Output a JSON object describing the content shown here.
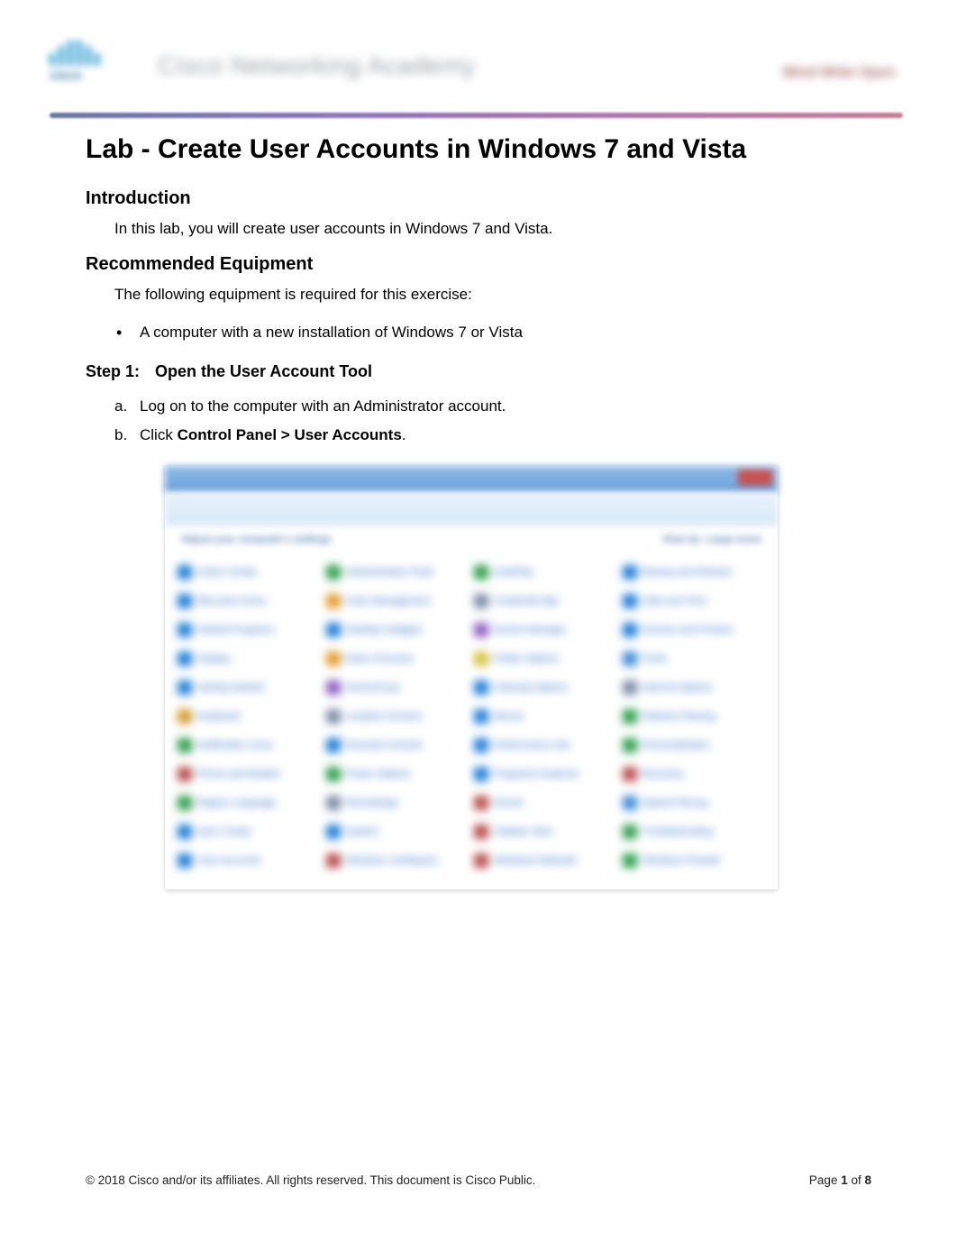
{
  "banner": {
    "logo_text": "cisco",
    "title": "Cisco Networking Academy",
    "right": "Mind Wide Open"
  },
  "doc": {
    "title": "Lab - Create User Accounts in Windows 7 and Vista",
    "intro_heading": "Introduction",
    "intro_body": "In this lab, you will create user accounts in Windows 7 and Vista.",
    "equip_heading": "Recommended Equipment",
    "equip_body": "The following equipment is required for this exercise:",
    "equip_items": [
      "A computer with a new installation of Windows 7 or Vista"
    ],
    "step1_label": "Step 1:",
    "step1_title": "Open the User Account Tool",
    "step1_items": [
      {
        "marker": "a.",
        "text": "Log on to the computer with an Administrator account."
      },
      {
        "marker": "b.",
        "prefix": "Click ",
        "bold": "Control Panel > User Accounts",
        "suffix": "."
      }
    ]
  },
  "screenshot": {
    "subbar_left": "Adjust your computer's settings",
    "subbar_right": "View by: Large icons",
    "items": [
      {
        "color": "#1f7dd8",
        "label": "Action Center"
      },
      {
        "color": "#2a9d4a",
        "label": "Administrative Tools"
      },
      {
        "color": "#2a9d4a",
        "label": "AutoPlay"
      },
      {
        "color": "#1f7dd8",
        "label": "Backup and Restore"
      },
      {
        "color": "#1f7dd8",
        "label": "BitLocker Drive..."
      },
      {
        "color": "#e39a2b",
        "label": "Color Management"
      },
      {
        "color": "#7a8aa5",
        "label": "Credential Mgr"
      },
      {
        "color": "#1f7dd8",
        "label": "Date and Time"
      },
      {
        "color": "#1f7dd8",
        "label": "Default Programs"
      },
      {
        "color": "#1f7dd8",
        "label": "Desktop Gadgets"
      },
      {
        "color": "#8a5cc2",
        "label": "Device Manager"
      },
      {
        "color": "#1f7dd8",
        "label": "Devices and Printers"
      },
      {
        "color": "#1f7dd8",
        "label": "Display"
      },
      {
        "color": "#e39a2b",
        "label": "Ease of Access"
      },
      {
        "color": "#d6c23a",
        "label": "Folder Options"
      },
      {
        "color": "#3a8ad6",
        "label": "Fonts"
      },
      {
        "color": "#1f7dd8",
        "label": "Getting Started"
      },
      {
        "color": "#8a5cc2",
        "label": "HomeGroup"
      },
      {
        "color": "#1f7dd8",
        "label": "Indexing Options"
      },
      {
        "color": "#7a8aa5",
        "label": "Internet Options"
      },
      {
        "color": "#d39a2b",
        "label": "Keyboard"
      },
      {
        "color": "#7a8aa5",
        "label": "Location Sensors"
      },
      {
        "color": "#1f7dd8",
        "label": "Mouse"
      },
      {
        "color": "#2a9d4a",
        "label": "Network Sharing"
      },
      {
        "color": "#2a9d4a",
        "label": "Notification Icons"
      },
      {
        "color": "#1f7dd8",
        "label": "Parental Controls"
      },
      {
        "color": "#1f7dd8",
        "label": "Performance Info"
      },
      {
        "color": "#2a9d4a",
        "label": "Personalization"
      },
      {
        "color": "#b84a4a",
        "label": "Phone and Modem"
      },
      {
        "color": "#2a9d4a",
        "label": "Power Options"
      },
      {
        "color": "#1f7dd8",
        "label": "Programs Features"
      },
      {
        "color": "#b84a4a",
        "label": "Recovery"
      },
      {
        "color": "#2a9d4a",
        "label": "Region Language"
      },
      {
        "color": "#7a8aa5",
        "label": "RemoteApp"
      },
      {
        "color": "#b84a4a",
        "label": "Sound"
      },
      {
        "color": "#3a8ad6",
        "label": "Speech Recog."
      },
      {
        "color": "#1f7dd8",
        "label": "Sync Center"
      },
      {
        "color": "#1f7dd8",
        "label": "System"
      },
      {
        "color": "#b84a4a",
        "label": "Taskbar Start"
      },
      {
        "color": "#2a9d4a",
        "label": "Troubleshooting"
      },
      {
        "color": "#1f7dd8",
        "label": "User Accounts"
      },
      {
        "color": "#b84a4a",
        "label": "Windows CardSpace"
      },
      {
        "color": "#b84a4a",
        "label": "Windows Defender"
      },
      {
        "color": "#2a9d4a",
        "label": "Windows Firewall"
      }
    ]
  },
  "footer": {
    "copyright": "© 2018 Cisco and/or its affiliates. All rights reserved. This document is Cisco Public.",
    "page_prefix": "Page ",
    "page_current": "1",
    "page_of": " of ",
    "page_total": "8"
  }
}
